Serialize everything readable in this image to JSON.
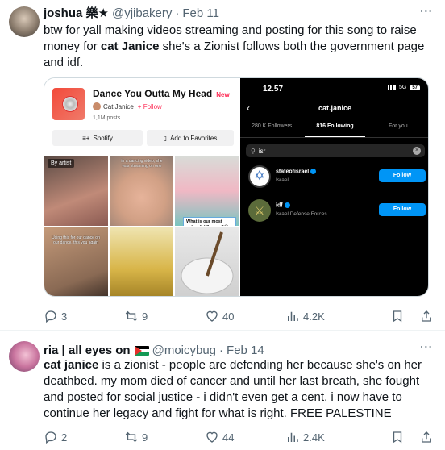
{
  "tweets": [
    {
      "display_name": "joshua 樂★",
      "handle": "@yjibakery",
      "separator": "·",
      "date": "Feb 11",
      "text_before": "btw for yall making videos streaming and posting for this song to raise money for ",
      "text_bold": "cat Janice",
      "text_after": " she's a Zionist follows both the government page and idf.",
      "actions": {
        "replies": "3",
        "retweets": "9",
        "likes": "40",
        "views": "4.2K"
      },
      "media": {
        "tiktok": {
          "song_title": "Dance You Outta My Head",
          "new_badge": "New",
          "artist": "Cat Janice",
          "follow_label": "+ Follow",
          "posts": "1,1M posts",
          "spotify_label": "Spotify",
          "favorites_label": "Add to Favorites",
          "by_artist_label": "By artist",
          "cell2_caption": "in a dancing video, she was streaming on one",
          "cell4_caption": "Using this for our dance on our dance, this you again",
          "flavour_caption": "What is our most colourful flavour?😊"
        },
        "instagram": {
          "time": "12.57",
          "network": "5G",
          "battery": "57",
          "profile_name": "cat.janice",
          "tabs": [
            "280 K Followers",
            "816 Following",
            "For you"
          ],
          "active_tab": 1,
          "search_value": "isr",
          "accounts": [
            {
              "name": "stateofisrael",
              "sub": "Israel",
              "button": "Follow"
            },
            {
              "name": "idf",
              "sub": "Israel Defense Forces",
              "button": "Follow"
            }
          ]
        }
      }
    },
    {
      "display_name": "ria | all eyes on",
      "handle": "@moicybug",
      "separator": "·",
      "date": "Feb 14",
      "text_bold": "cat janice",
      "text_after": " is a zionist - people are defending her because she's on her deathbed. my mom died of cancer and until her last breath, she fought and posted for social justice - i didn't even get a cent. i now have to continue her legacy and fight for what is right. FREE PALESTINE",
      "actions": {
        "replies": "2",
        "retweets": "9",
        "likes": "44",
        "views": "2.4K"
      }
    }
  ],
  "colors": {
    "secondary_text": "#536471",
    "tiktok_accent": "#fe2c55",
    "instagram_blue": "#0095f6"
  }
}
